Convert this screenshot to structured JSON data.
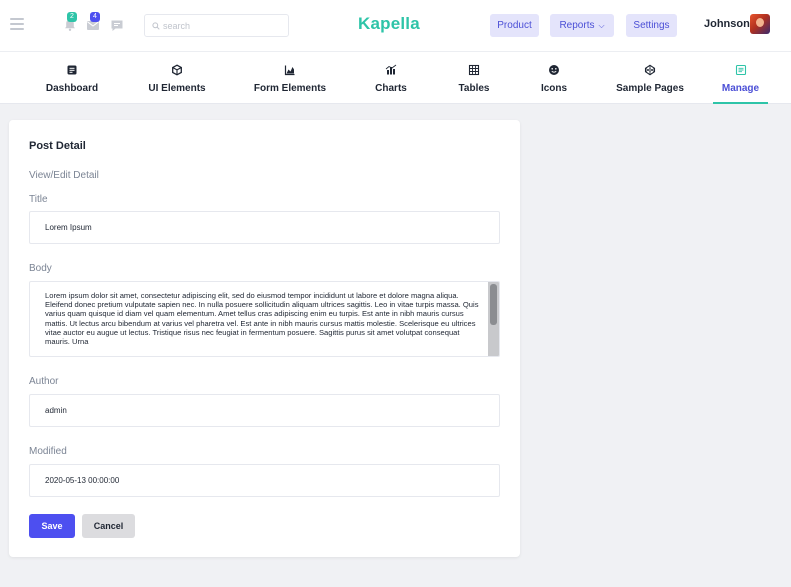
{
  "topbar": {
    "search_placeholder": "search",
    "notifications_count": "2",
    "mail_count": "4",
    "brand": "Kapella",
    "product_label": "Product",
    "reports_label": "Reports",
    "settings_label": "Settings",
    "username": "Johnson"
  },
  "nav": {
    "items": [
      {
        "label": "Dashboard",
        "icon": "dashboard-icon"
      },
      {
        "label": "UI Elements",
        "icon": "cube-icon"
      },
      {
        "label": "Form Elements",
        "icon": "chart-area-icon"
      },
      {
        "label": "Charts",
        "icon": "chart-icon"
      },
      {
        "label": "Tables",
        "icon": "grid-icon"
      },
      {
        "label": "Icons",
        "icon": "emoji-icon"
      },
      {
        "label": "Sample Pages",
        "icon": "codepen-icon"
      },
      {
        "label": "Manage",
        "icon": "list-icon"
      }
    ],
    "active": "Manage"
  },
  "card": {
    "title": "Post Detail",
    "subtitle": "View/Edit Detail",
    "title_label": "Title",
    "title_value": "Lorem Ipsum",
    "body_label": "Body",
    "body_value": "Lorem ipsum dolor sit amet, consectetur adipiscing elit, sed do eiusmod tempor incididunt ut labore et dolore magna aliqua. Eleifend donec pretium vulputate sapien nec. In nulla posuere sollicitudin aliquam ultrices sagittis. Leo in vitae turpis massa. Quis varius quam quisque id diam vel quam elementum. Amet tellus cras adipiscing enim eu turpis. Est ante in nibh mauris cursus mattis. Ut lectus arcu bibendum at varius vel pharetra vel. Est ante in nibh mauris cursus mattis molestie. Scelerisque eu ultrices vitae auctor eu augue ut lectus. Tristique risus nec feugiat in fermentum posuere. Sagittis purus sit amet volutpat consequat mauris. Urna",
    "author_label": "Author",
    "author_value": "admin",
    "modified_label": "Modified",
    "modified_value": "2020-05-13 00:00:00",
    "save_label": "Save",
    "cancel_label": "Cancel"
  },
  "colors": {
    "brand": "#2ec4a8",
    "accent": "#4d4ff0",
    "badge_green": "#2ec4a8",
    "badge_blue": "#4d4ff0"
  }
}
